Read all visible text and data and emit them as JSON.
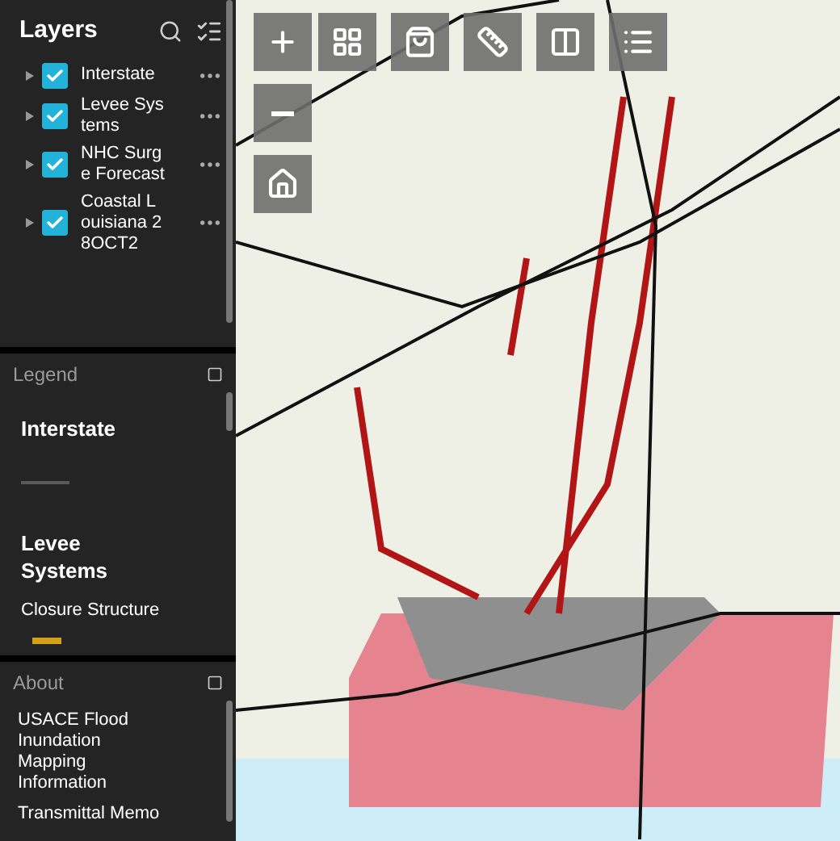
{
  "layers_panel": {
    "title": "Layers",
    "items": [
      {
        "label": "Interstate",
        "checked": true,
        "expanded": false
      },
      {
        "label": "Levee Systems",
        "checked": true,
        "expanded": false
      },
      {
        "label": "NHC Surge Forecast",
        "checked": true,
        "expanded": false
      },
      {
        "label": "Coastal Louisiana 28OCT2",
        "checked": true,
        "expanded": false
      }
    ]
  },
  "legend_panel": {
    "title": "Legend",
    "entries": [
      {
        "kind": "heading",
        "text": "Interstate"
      },
      {
        "kind": "line",
        "color": "#5a5a5a"
      },
      {
        "kind": "heading",
        "text": "Levee Systems"
      },
      {
        "kind": "label",
        "text": "Closure Structure"
      },
      {
        "kind": "swatch",
        "color": "#d4a017"
      }
    ]
  },
  "about_panel": {
    "title": "About",
    "paragraphs": [
      "USACE Flood Inundation Mapping Information",
      "Transmittal Memo"
    ]
  }
}
